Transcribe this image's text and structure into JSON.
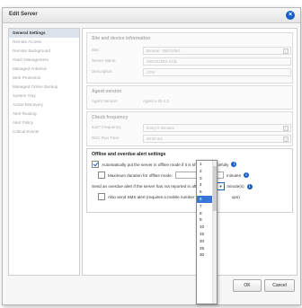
{
  "window": {
    "title": "Edit Server"
  },
  "nav": {
    "items": [
      {
        "label": "General Settings",
        "active": true
      },
      {
        "label": "Remote Access",
        "active": false
      },
      {
        "label": "Remote Background",
        "active": false
      },
      {
        "label": "Patch Management",
        "active": false
      },
      {
        "label": "Managed Antivirus",
        "active": false
      },
      {
        "label": "Web Protection",
        "active": false
      },
      {
        "label": "Managed Online Backup",
        "active": false
      },
      {
        "label": "System Tray",
        "active": false
      },
      {
        "label": "Active Discovery",
        "active": false
      },
      {
        "label": "Alert Routing",
        "active": false
      },
      {
        "label": "Alert Policy",
        "active": false
      },
      {
        "label": "Critical Events",
        "active": false
      }
    ]
  },
  "site_info": {
    "title": "Site and device information",
    "site_label": "Site:",
    "site_value": "Browse - BitOrSite1",
    "server_name_label": "Server Name:",
    "server_name_value": "WIN2012R2-SCB",
    "description_label": "Description:",
    "description_value": "CP.0"
  },
  "agent_version": {
    "title": "Agent version",
    "label": "Agent Version:",
    "value": "Agent v.10.4.3"
  },
  "check_frequency": {
    "title": "Check frequency",
    "dtc_label": "24x7 Frequency:",
    "dtc_value": "Every 5 minutes",
    "dsc_label": "DSC Run Time:",
    "dsc_value": "06:00 am"
  },
  "offline_alert": {
    "title": "Offline and overdue alert settings",
    "auto_offline_label": "Automatically put the server in offline mode if it is shutdown gracefully",
    "auto_offline_checked": true,
    "max_duration_label": "Maximum duration for offline mode:",
    "max_duration_unit": "minutes",
    "max_duration_checked": false,
    "overdue_label": "Send an overdue alert if the server has not reported in after",
    "overdue_selected": "",
    "overdue_unit": "minute(s)",
    "sms_label": "Also send SMS alert (requires a mobile number in Alert",
    "sms_suffix": "ups)",
    "sms_checked": false
  },
  "dropdown": {
    "options": [
      "1",
      "2",
      "3",
      "4",
      "5",
      "6",
      "7",
      "8",
      "9",
      "10",
      "15",
      "20",
      "25",
      "30"
    ],
    "selected": "6"
  },
  "footer": {
    "ok_label": "OK",
    "cancel_label": "Cancel"
  },
  "icons": {
    "info": "info-icon",
    "close": "close-icon"
  },
  "colors": {
    "accent": "#1a5fc7",
    "selected_row": "#3875d7"
  }
}
